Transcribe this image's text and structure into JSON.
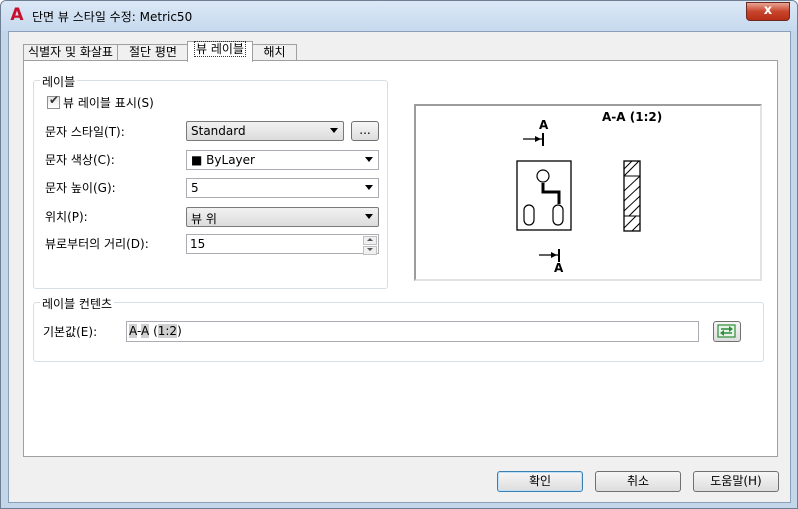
{
  "window": {
    "title": "단면 뷰 스타일 수정: Metric50",
    "app_icon": "A",
    "close_glyph": "x"
  },
  "tabs": [
    {
      "label": "식별자 및 화살표",
      "selected": false
    },
    {
      "label": "절단 평면",
      "selected": false
    },
    {
      "label": "뷰 레이블",
      "selected": true
    },
    {
      "label": "해치",
      "selected": false
    }
  ],
  "view_label_group": {
    "title": "레이블",
    "show_label_checkbox": {
      "label": "뷰 레이블 표시(S)",
      "checked": true
    },
    "text_style": {
      "label": "문자 스타일(T):",
      "value": "Standard",
      "browse_label": "..."
    },
    "text_color": {
      "label": "문자 색상(C):",
      "value": "ByLayer",
      "swatch": "■"
    },
    "text_height": {
      "label": "문자 높이(G):",
      "value": "5"
    },
    "location": {
      "label": "위치(P):",
      "value": "뷰 위"
    },
    "distance_from_view": {
      "label": "뷰로부터의 거리(D):",
      "value": "15"
    }
  },
  "preview": {
    "label_text": "A-A (1:2)",
    "top_letter": "A",
    "bottom_letter": "A"
  },
  "contents_group": {
    "title": "레이블 컨텐츠",
    "default_label": "기본값(E):",
    "value_parts": [
      {
        "text": "A",
        "highlight": true
      },
      {
        "text": "-",
        "highlight": false
      },
      {
        "text": "A",
        "highlight": true
      },
      {
        "text": " (",
        "highlight": false
      },
      {
        "text": "1:2",
        "highlight": true
      },
      {
        "text": ")",
        "highlight": false
      }
    ],
    "field_button_icon": "insert-field-icon"
  },
  "footer": {
    "ok_label": "확인",
    "cancel_label": "취소",
    "help_label": "도움말(H)"
  },
  "colors": {
    "title_bar": "#c6d9ee",
    "close_button": "#c7452c",
    "dialog_bg": "#f0f0f0",
    "field_button_green": "#2e8b3a"
  }
}
